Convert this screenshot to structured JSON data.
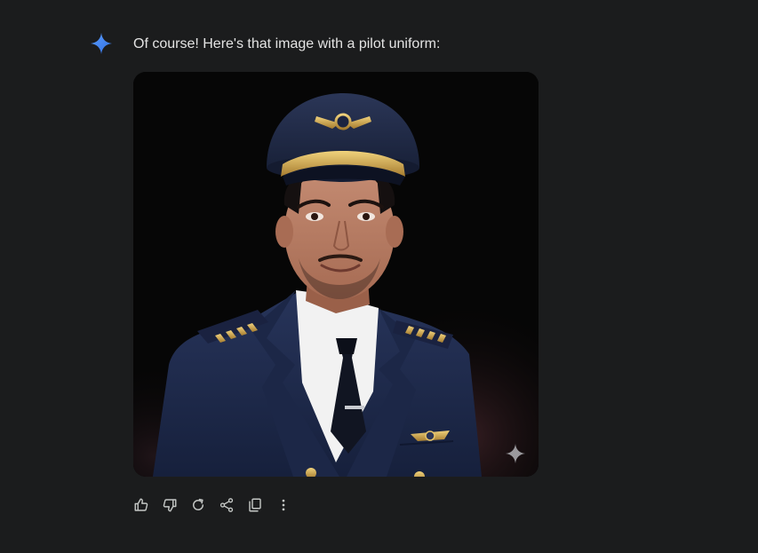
{
  "message": {
    "text": "Of course! Here's that image with a pilot uniform:"
  },
  "icons": {
    "logo": "gemini-sparkle-icon",
    "watermark": "sparkle-watermark-icon",
    "toolbar": [
      "thumbs-up-icon",
      "thumbs-down-icon",
      "regenerate-icon",
      "share-icon",
      "copy-icon",
      "more-vert-icon"
    ]
  },
  "colors": {
    "background": "#1b1c1d",
    "text": "#e3e3e3",
    "icon": "#c4c7c5",
    "gemini_blue": "#4a8af4",
    "uniform_navy": "#1f2c4d",
    "gold": "#d8b25a"
  }
}
